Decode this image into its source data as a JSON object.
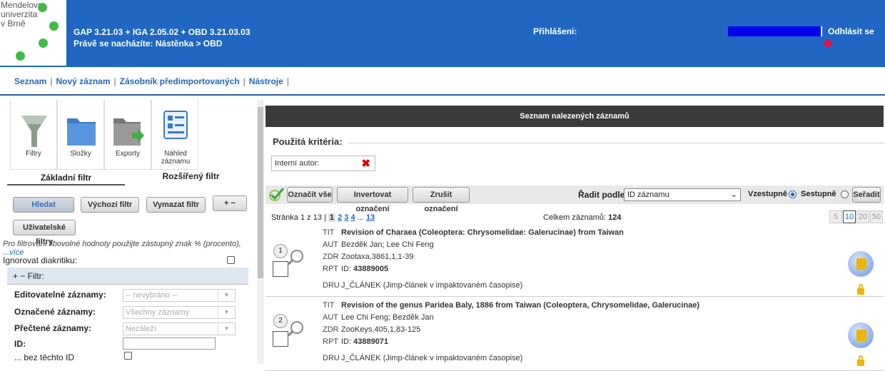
{
  "header": {
    "logo_lines": [
      "Mendelova",
      "univerzita",
      "v Brně"
    ],
    "version": "GAP 3.21.03 + IGA 2.05.02 + OBD 3.21.03.03",
    "location": "Právě se nacházíte: Nástěnka  >  OBD",
    "logged_in_label": "Přihlášeni:",
    "logout_label": "Odhlásit se"
  },
  "nav": [
    "Seznam",
    "Nový záznam",
    "Zásobník předimportovaných",
    "Nástroje"
  ],
  "tools": [
    "Filtry",
    "Složky",
    "Exporty",
    "Náhled záznamu"
  ],
  "tabs": {
    "basic": "Základní filtr",
    "advanced": "Rozšířený filtr"
  },
  "filter_buttons": {
    "search": "Hledat",
    "default": "Výchozí filtr",
    "clear": "Vymazat filtr",
    "plusminus": "+ −",
    "user": "Uživatelské filtry"
  },
  "hint": {
    "text": "Pro filtrování libovolné hodnoty použijte zástupný znak % (procento), ...",
    "more": "více"
  },
  "ignore_diacritics": "Ignorovat diakritiku:",
  "filter_bar": "+  −    Filtr:",
  "filter_rows": [
    {
      "label": "Editovatelné záznamy:",
      "value": "-- nevybráno --"
    },
    {
      "label": "Označené záznamy:",
      "value": "Všechny záznamy"
    },
    {
      "label": "Přečtené záznamy:",
      "value": "Nezáleží"
    }
  ],
  "id_label": "ID:",
  "without_ids": "... bez těchto ID",
  "results": {
    "title": "Seznam nalezených záznamů",
    "criteria_label": "Použitá kritéria:",
    "criteria_item": "Interní autor:",
    "mark_all": "Označit vše",
    "invert": "Invertovat označení",
    "unmark": "Zrušit označení",
    "sort_label": "Řadit podle:",
    "sort_value": "ID záznamu",
    "asc": "Vzestupně",
    "desc": "Sestupně",
    "sort_btn": "Seřadit",
    "page_info": "Stránka 1 z 13 |",
    "pages": [
      "1",
      "2",
      "3",
      "4",
      "...",
      "13"
    ],
    "total_label": "Celkem záznamů:",
    "total": "124",
    "page_sizes": [
      "5",
      "10",
      "20",
      "50"
    ]
  },
  "records": [
    {
      "num": "1",
      "tit": "Revision of Charaea (Coleoptera: Chrysomelidae: Galerucinae) from Taiwan",
      "aut": "Bezděk Jan; Lee Chi Feng",
      "zdr": "Zootaxa,3861,1,1-39",
      "rpt": "43889005",
      "dru": "J_ČLÁNEK  (Jimp-článek v impaktovaném časopise)"
    },
    {
      "num": "2",
      "tit": "Revision of the genus Paridea Baly, 1886 from Taiwan (Coleoptera, Chrysomelidae, Galerucinae)",
      "aut": "Lee Chi Feng; Bezděk Jan",
      "zdr": "ZooKeys,405,1,83-125",
      "rpt": "43889071",
      "dru": "J_ČLÁNEK  (Jimp-článek v impaktovaném časopise)"
    }
  ],
  "field_keys": {
    "tit": "TIT",
    "aut": "AUT",
    "zdr": "ZDR",
    "rpt": "RPT",
    "dru": "DRU",
    "id_prefix": "ID:"
  }
}
